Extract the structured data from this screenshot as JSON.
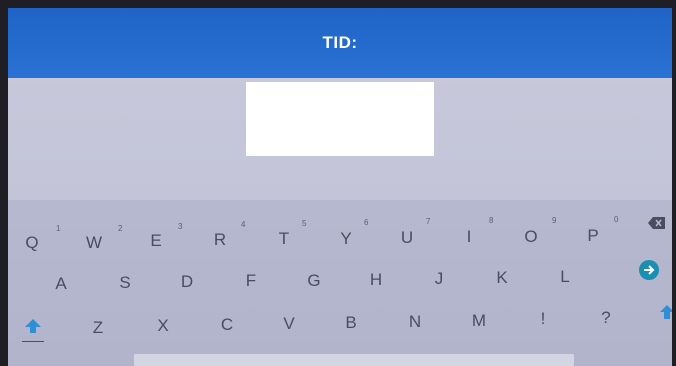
{
  "header": {
    "title": "TID:"
  },
  "tid_field": {
    "value": ""
  },
  "keyboard": {
    "row1": [
      {
        "label": "Q",
        "hint": "1"
      },
      {
        "label": "W",
        "hint": "2"
      },
      {
        "label": "E",
        "hint": "3"
      },
      {
        "label": "R",
        "hint": "4"
      },
      {
        "label": "T",
        "hint": "5"
      },
      {
        "label": "Y",
        "hint": "6"
      },
      {
        "label": "U",
        "hint": "7"
      },
      {
        "label": "I",
        "hint": "8"
      },
      {
        "label": "O",
        "hint": "9"
      },
      {
        "label": "P",
        "hint": "0"
      }
    ],
    "row2": [
      "A",
      "S",
      "D",
      "F",
      "G",
      "H",
      "J",
      "K",
      "L"
    ],
    "row3": [
      "Z",
      "X",
      "C",
      "V",
      "B",
      "N",
      "M",
      "!",
      "?"
    ],
    "icons": {
      "backspace": "backspace-icon",
      "enter": "go-arrow-icon",
      "shift_left": "shift-icon",
      "shift_right": "shift-icon"
    },
    "colors": {
      "enter_button": "#1a8fb0",
      "shift": "#2f8fd6",
      "header": "#1f63c6"
    }
  }
}
